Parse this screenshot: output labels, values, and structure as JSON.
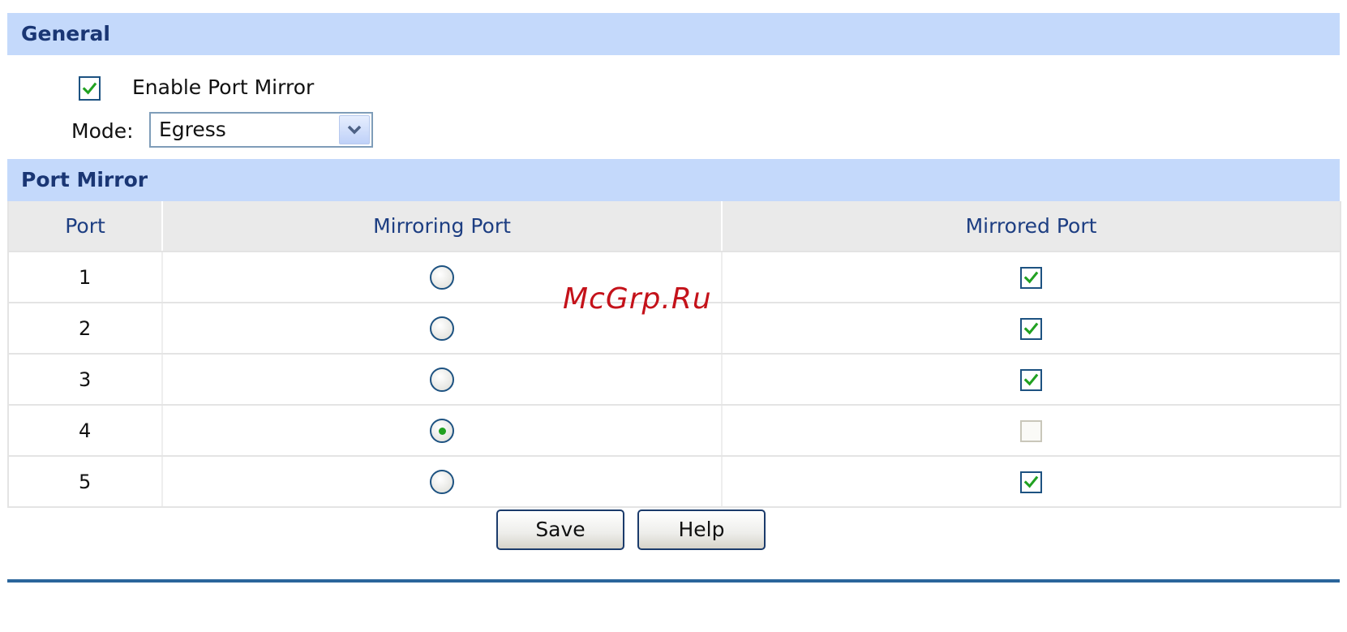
{
  "general": {
    "title": "General",
    "enable_label": "Enable Port Mirror",
    "enable_checked": true,
    "mode_label": "Mode:",
    "mode_value": "Egress"
  },
  "port_mirror": {
    "title": "Port Mirror",
    "columns": [
      "Port",
      "Mirroring Port",
      "Mirrored Port"
    ],
    "rows": [
      {
        "port": "1",
        "mirroring": false,
        "mirrored": true
      },
      {
        "port": "2",
        "mirroring": false,
        "mirrored": true
      },
      {
        "port": "3",
        "mirroring": false,
        "mirrored": true
      },
      {
        "port": "4",
        "mirroring": true,
        "mirrored": false
      },
      {
        "port": "5",
        "mirroring": false,
        "mirrored": true
      }
    ]
  },
  "buttons": {
    "save": "Save",
    "help": "Help"
  },
  "watermark": "McGrp.Ru",
  "colors": {
    "header_bg": "#c4d9fb",
    "header_text": "#1a3674",
    "check_green": "#21a121",
    "footer_line": "#2a659b"
  }
}
